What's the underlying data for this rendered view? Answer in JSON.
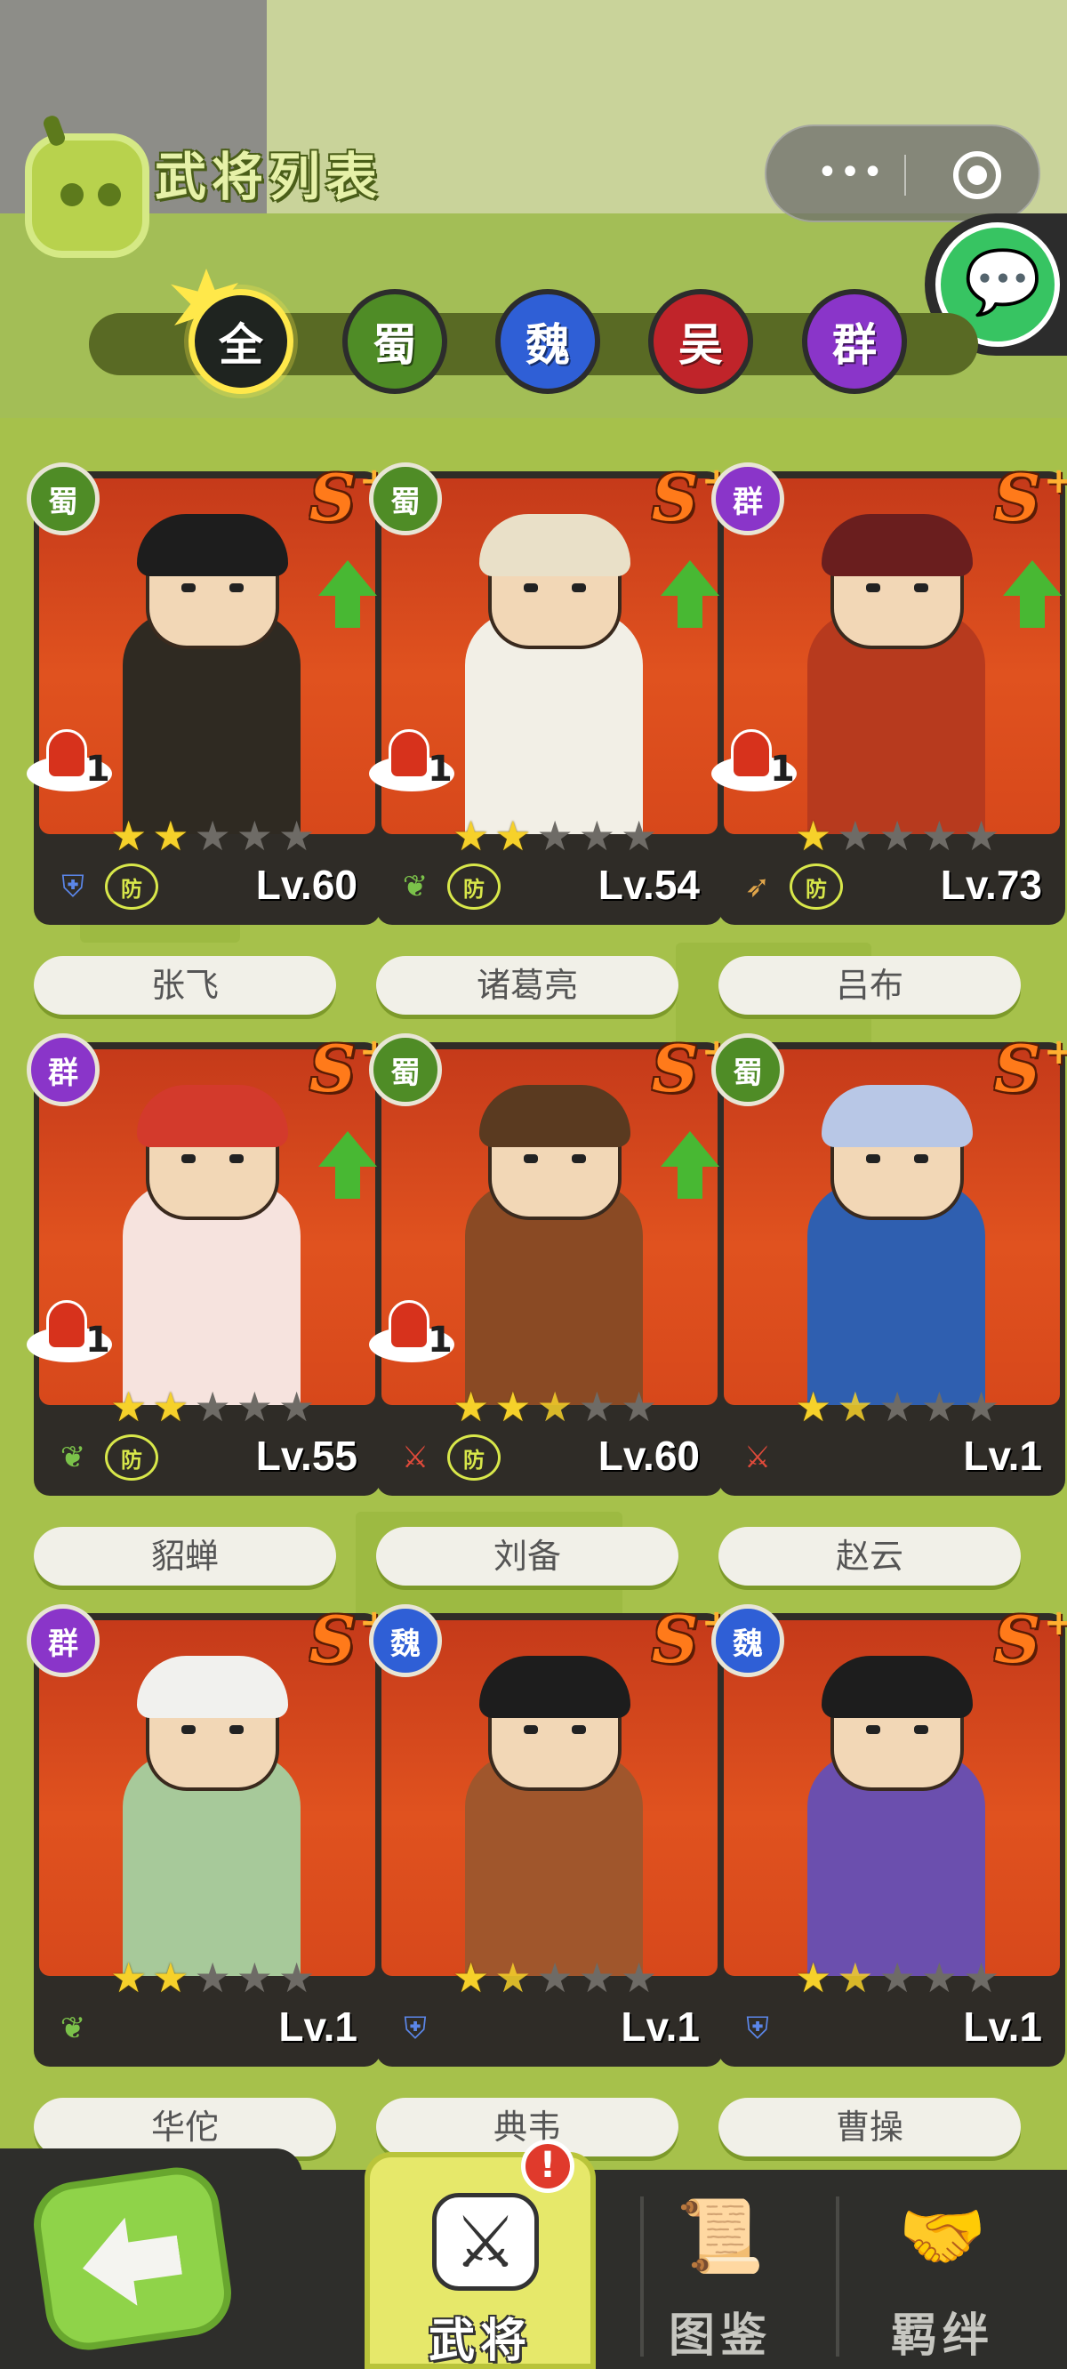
{
  "header": {
    "title": "武将列表",
    "capsule_more": "•••"
  },
  "factions": [
    {
      "label": "全",
      "color": "#1f2420",
      "active": true
    },
    {
      "label": "蜀",
      "color": "#4f8c26",
      "active": false
    },
    {
      "label": "魏",
      "color": "#2f5fd6",
      "active": false
    },
    {
      "label": "吴",
      "color": "#c0242a",
      "active": false
    },
    {
      "label": "群",
      "color": "#8a35c9",
      "active": false
    }
  ],
  "cards": [
    {
      "name": "张飞",
      "faction": "蜀",
      "faction_color": "#4f8c26",
      "rank": "S",
      "rank_plus": "+",
      "level": "Lv.60",
      "stars": 2,
      "half_star": false,
      "upgrade": true,
      "stack_count": "1",
      "type_icon": "shield-icon",
      "type_color": "#5b86e8",
      "def_label": "防",
      "show_def": true,
      "hair_color": "#1d1d1d",
      "body_color": "#2f2a22"
    },
    {
      "name": "诸葛亮",
      "faction": "蜀",
      "faction_color": "#4f8c26",
      "rank": "S",
      "rank_plus": "+",
      "level": "Lv.54",
      "stars": 2,
      "half_star": false,
      "upgrade": true,
      "stack_count": "1",
      "type_icon": "leaf-icon",
      "type_color": "#7bc24a",
      "def_label": "防",
      "show_def": true,
      "hair_color": "#e9e0c8",
      "body_color": "#f2efe6"
    },
    {
      "name": "吕布",
      "faction": "群",
      "faction_color": "#8a35c9",
      "rank": "S",
      "rank_plus": "+",
      "level": "Lv.73",
      "stars": 1,
      "half_star": false,
      "upgrade": true,
      "stack_count": "1",
      "type_icon": "bow-icon",
      "type_color": "#e0a54a",
      "def_label": "防",
      "show_def": true,
      "hair_color": "#6a1e1e",
      "body_color": "#b73a1e"
    },
    {
      "name": "貂蝉",
      "faction": "群",
      "faction_color": "#8a35c9",
      "rank": "S",
      "rank_plus": "+",
      "level": "Lv.55",
      "stars": 2,
      "half_star": false,
      "upgrade": true,
      "stack_count": "1",
      "type_icon": "leaf-icon",
      "type_color": "#7bc24a",
      "def_label": "防",
      "show_def": true,
      "hair_color": "#d33a2c",
      "body_color": "#f6e3de"
    },
    {
      "name": "刘备",
      "faction": "蜀",
      "faction_color": "#4f8c26",
      "rank": "S",
      "rank_plus": "+",
      "level": "Lv.60",
      "stars": 2,
      "half_star": true,
      "upgrade": true,
      "stack_count": "1",
      "type_icon": "sword-icon",
      "type_color": "#e04a3a",
      "def_label": "防",
      "show_def": true,
      "hair_color": "#5a3a20",
      "body_color": "#8a4a24"
    },
    {
      "name": "赵云",
      "faction": "蜀",
      "faction_color": "#4f8c26",
      "rank": "S",
      "rank_plus": "+",
      "level": "Lv.1",
      "stars": 1,
      "half_star": true,
      "upgrade": false,
      "stack_count": "",
      "type_icon": "sword-icon",
      "type_color": "#e04a3a",
      "def_label": "",
      "show_def": false,
      "hair_color": "#b8c7e6",
      "body_color": "#2f5fb0"
    },
    {
      "name": "华佗",
      "faction": "群",
      "faction_color": "#8a35c9",
      "rank": "S",
      "rank_plus": "+",
      "level": "Lv.1",
      "stars": 2,
      "half_star": false,
      "upgrade": false,
      "stack_count": "",
      "type_icon": "leaf-icon",
      "type_color": "#7bc24a",
      "def_label": "",
      "show_def": false,
      "hair_color": "#f1f1ee",
      "body_color": "#a7c99a"
    },
    {
      "name": "典韦",
      "faction": "魏",
      "faction_color": "#2f5fd6",
      "rank": "S",
      "rank_plus": "+",
      "level": "Lv.1",
      "stars": 1,
      "half_star": true,
      "upgrade": false,
      "stack_count": "",
      "type_icon": "shield-icon",
      "type_color": "#5b86e8",
      "def_label": "",
      "show_def": false,
      "hair_color": "#1d1d1d",
      "body_color": "#a0562c"
    },
    {
      "name": "曹操",
      "faction": "魏",
      "faction_color": "#2f5fd6",
      "rank": "S",
      "rank_plus": "+",
      "level": "Lv.1",
      "stars": 1,
      "half_star": true,
      "upgrade": false,
      "stack_count": "",
      "type_icon": "shield-icon",
      "type_color": "#5b86e8",
      "def_label": "",
      "show_def": false,
      "hair_color": "#1d1d1d",
      "body_color": "#6b4fae"
    }
  ],
  "bottom_nav": {
    "tabs": [
      {
        "label": "武将",
        "active": true,
        "icon": "general-shield-icon"
      },
      {
        "label": "图鉴",
        "active": false,
        "icon": "scroll-icon"
      },
      {
        "label": "羁绊",
        "active": false,
        "icon": "handshake-icon"
      }
    ],
    "alert": "!"
  }
}
